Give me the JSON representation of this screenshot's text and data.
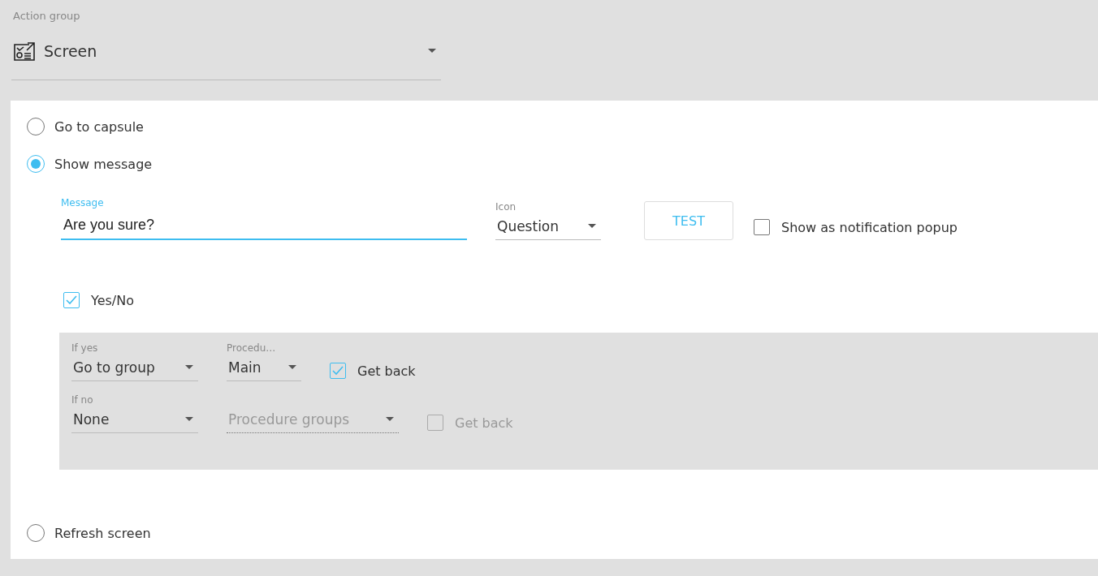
{
  "action_group": {
    "label": "Action group",
    "value": "Screen"
  },
  "actions": [
    {
      "label": "Go to capsule",
      "selected": false
    },
    {
      "label": "Show message",
      "selected": true,
      "details": {
        "message": {
          "label": "Message",
          "value": "Are you sure?"
        },
        "icon": {
          "label": "Icon",
          "value": "Question"
        },
        "test_button": "TEST",
        "notification_popup": {
          "label": "Show as notification popup",
          "checked": false
        },
        "yes_no": {
          "label": "Yes/No",
          "checked": true
        },
        "branches": [
          {
            "label": "If yes",
            "action": "Go to group",
            "procedure": {
              "label": "Procedu…",
              "value": "Main",
              "disabled": false
            },
            "get_back": {
              "label": "Get back",
              "checked": true,
              "disabled": false
            }
          },
          {
            "label": "If no",
            "action": "None",
            "procedure": {
              "value": "Procedure groups",
              "disabled": true
            },
            "get_back": {
              "label": "Get back",
              "checked": false,
              "disabled": true
            }
          }
        ]
      }
    },
    {
      "label": "Refresh screen",
      "selected": false
    }
  ]
}
